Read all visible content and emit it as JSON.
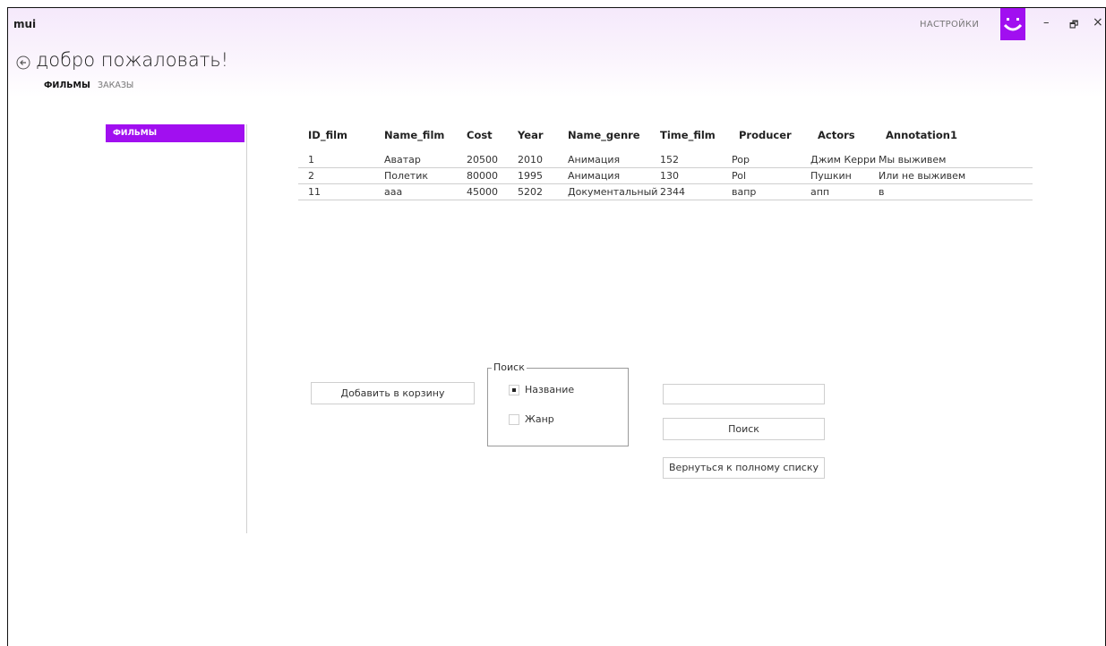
{
  "window": {
    "app_name": "mui",
    "settings_label": "НАСТРОЙКИ",
    "controls": {
      "minimize": "–",
      "maximize": "🗗",
      "close": "×"
    }
  },
  "header": {
    "title": "добро пожаловать!",
    "tabs": [
      {
        "label": "ФИЛЬМЫ"
      },
      {
        "label": "ЗАКАЗЫ"
      }
    ]
  },
  "sidebar": {
    "items": [
      {
        "label": "ФИЛЬМЫ"
      }
    ]
  },
  "grid": {
    "columns": [
      "ID_film",
      "Name_film",
      "Cost",
      "Year",
      "Name_genre",
      "Time_film",
      "Producer",
      "Actors",
      "Annotation1"
    ],
    "rows": [
      [
        "1",
        "Аватар",
        "20500",
        "2010",
        "Анимация",
        "152",
        "Pop",
        "Джим Керри",
        "Мы выживем"
      ],
      [
        "2",
        "Полетик",
        "80000",
        "1995",
        "Анимация",
        "130",
        "Pol",
        "Пушкин",
        "Или не выживем"
      ],
      [
        "11",
        "ааа",
        "45000",
        "5202",
        "Документальный",
        "2344",
        "вапр",
        "апп",
        "в"
      ]
    ]
  },
  "actions": {
    "add_to_cart_label": "Добавить в корзину",
    "search_button_label": "Поиск",
    "reset_button_label": "Вернуться к полному списку"
  },
  "search_group": {
    "legend": "Поиск",
    "options": [
      {
        "label": "Название",
        "checked": true
      },
      {
        "label": "Жанр",
        "checked": false
      }
    ]
  },
  "search": {
    "value": "",
    "placeholder": ""
  },
  "colors": {
    "accent": "#a10ff0"
  }
}
